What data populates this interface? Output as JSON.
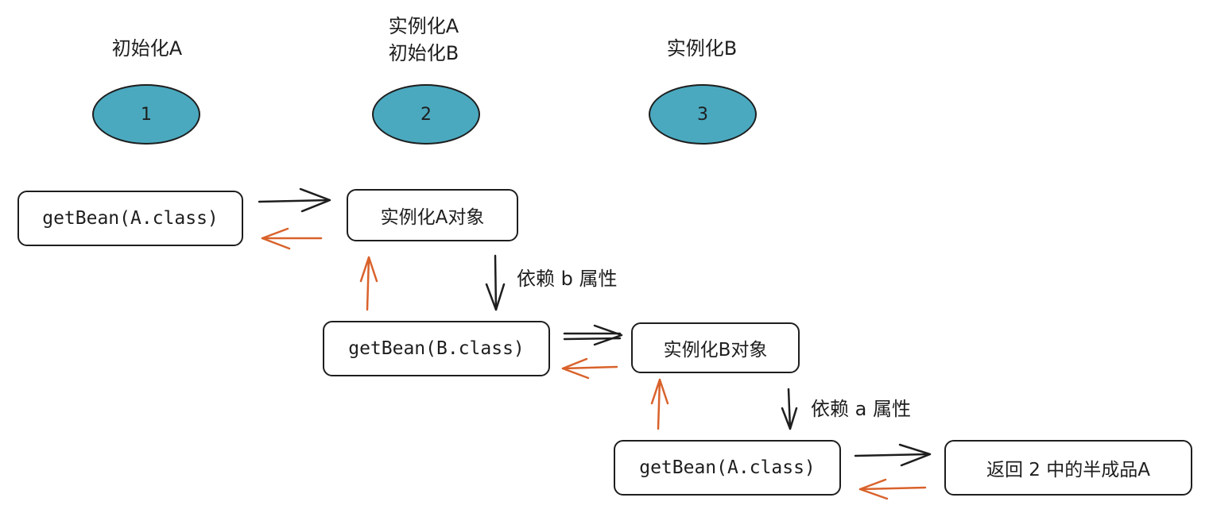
{
  "steps": [
    {
      "number": "1",
      "caption_lines": [
        "初始化A"
      ]
    },
    {
      "number": "2",
      "caption_lines": [
        "实例化A",
        "初始化B"
      ]
    },
    {
      "number": "3",
      "caption_lines": [
        "实例化B"
      ]
    }
  ],
  "nodes": {
    "get_bean_a_1": "getBean(A.class)",
    "instantiate_a": "实例化A对象",
    "get_bean_b": "getBean(B.class)",
    "instantiate_b": "实例化B对象",
    "get_bean_a_2": "getBean(A.class)",
    "return_half_a": "返回 2 中的半成品A"
  },
  "edge_labels": {
    "depends_b": "依赖 b 属性",
    "depends_a": "依赖 a 属性"
  },
  "colors": {
    "step_fill": "#4aa9bf",
    "stroke": "#1e1e1e",
    "return_arrow": "#d9622b"
  }
}
